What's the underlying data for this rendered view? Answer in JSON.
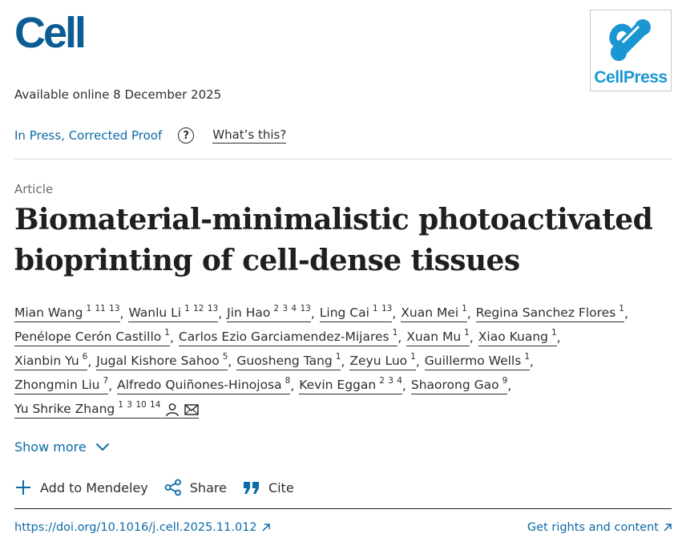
{
  "journal": {
    "logo_text": "Cell"
  },
  "publisher": {
    "logo_text": "CellPress"
  },
  "available": "Available online 8 December 2025",
  "status": {
    "label": "In Press, Corrected Proof",
    "help_icon": "question-circle-icon",
    "whats_this": "What’s this?"
  },
  "article_type": "Article",
  "title": "Biomaterial-minimalistic photoactivated bioprinting of cell-dense tissues",
  "authors": [
    {
      "name": "Mian Wang",
      "affils": "1 11 13"
    },
    {
      "name": "Wanlu Li",
      "affils": "1 12 13"
    },
    {
      "name": "Jin Hao",
      "affils": "2 3 4 13"
    },
    {
      "name": "Ling Cai",
      "affils": "1 13"
    },
    {
      "name": "Xuan Mei",
      "affils": "1"
    },
    {
      "name": "Regina Sanchez Flores",
      "affils": "1"
    },
    {
      "name": "Penélope Cerón Castillo",
      "affils": "1"
    },
    {
      "name": "Carlos Ezio Garciamendez-Mijares",
      "affils": "1"
    },
    {
      "name": "Xuan Mu",
      "affils": "1"
    },
    {
      "name": "Xiao Kuang",
      "affils": "1"
    },
    {
      "name": "Xianbin Yu",
      "affils": "6"
    },
    {
      "name": "Jugal Kishore Sahoo",
      "affils": "5"
    },
    {
      "name": "Guosheng Tang",
      "affils": "1"
    },
    {
      "name": "Zeyu Luo",
      "affils": "1"
    },
    {
      "name": "Guillermo Wells",
      "affils": "1"
    },
    {
      "name": "Zhongmin Liu",
      "affils": "7"
    },
    {
      "name": "Alfredo Quiñones-Hinojosa",
      "affils": "8"
    },
    {
      "name": "Kevin Eggan",
      "affils": "2 3 4"
    },
    {
      "name": "Shaorong Gao",
      "affils": "9"
    },
    {
      "name": "Yu Shrike Zhang",
      "affils": "1 3 10 14"
    }
  ],
  "separator": ",",
  "show_more": "Show more",
  "actions": {
    "mendeley": "Add to Mendeley",
    "share": "Share",
    "cite": "Cite"
  },
  "doi": "https://doi.org/10.1016/j.cell.2025.11.012",
  "rights": "Get rights and content",
  "colors": {
    "brand_blue": "#0c5c94",
    "link_blue": "#0c6aa8",
    "cellpress_blue": "#1a96d3"
  }
}
